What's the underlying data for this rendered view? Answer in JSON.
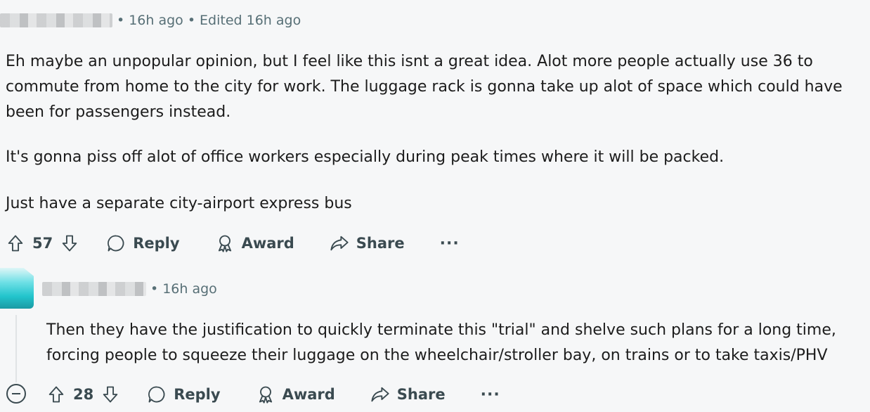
{
  "comment1": {
    "time": "16h ago",
    "edited": "Edited 16h ago",
    "paragraphs": [
      "Eh maybe an unpopular opinion, but I feel like this isnt a great idea. Alot more people actually use 36 to commute from home to the city for work. The luggage rack is gonna take up alot of space which could have been for passengers instead.",
      "It's gonna piss off alot of office workers especially during peak times where it will be packed.",
      "Just have a separate city-airport express bus"
    ],
    "votes": "57",
    "reply_label": "Reply",
    "award_label": "Award",
    "share_label": "Share",
    "more_label": "···"
  },
  "comment2": {
    "time": "16h ago",
    "paragraphs": [
      "Then they have the justification to quickly terminate this \"trial\" and shelve such plans for a long time, forcing people to squeeze their luggage on the wheelchair/stroller bay, on trains or to take taxis/PHV"
    ],
    "votes": "28",
    "reply_label": "Reply",
    "award_label": "Award",
    "share_label": "Share",
    "more_label": "···"
  },
  "meta_separator": "•"
}
